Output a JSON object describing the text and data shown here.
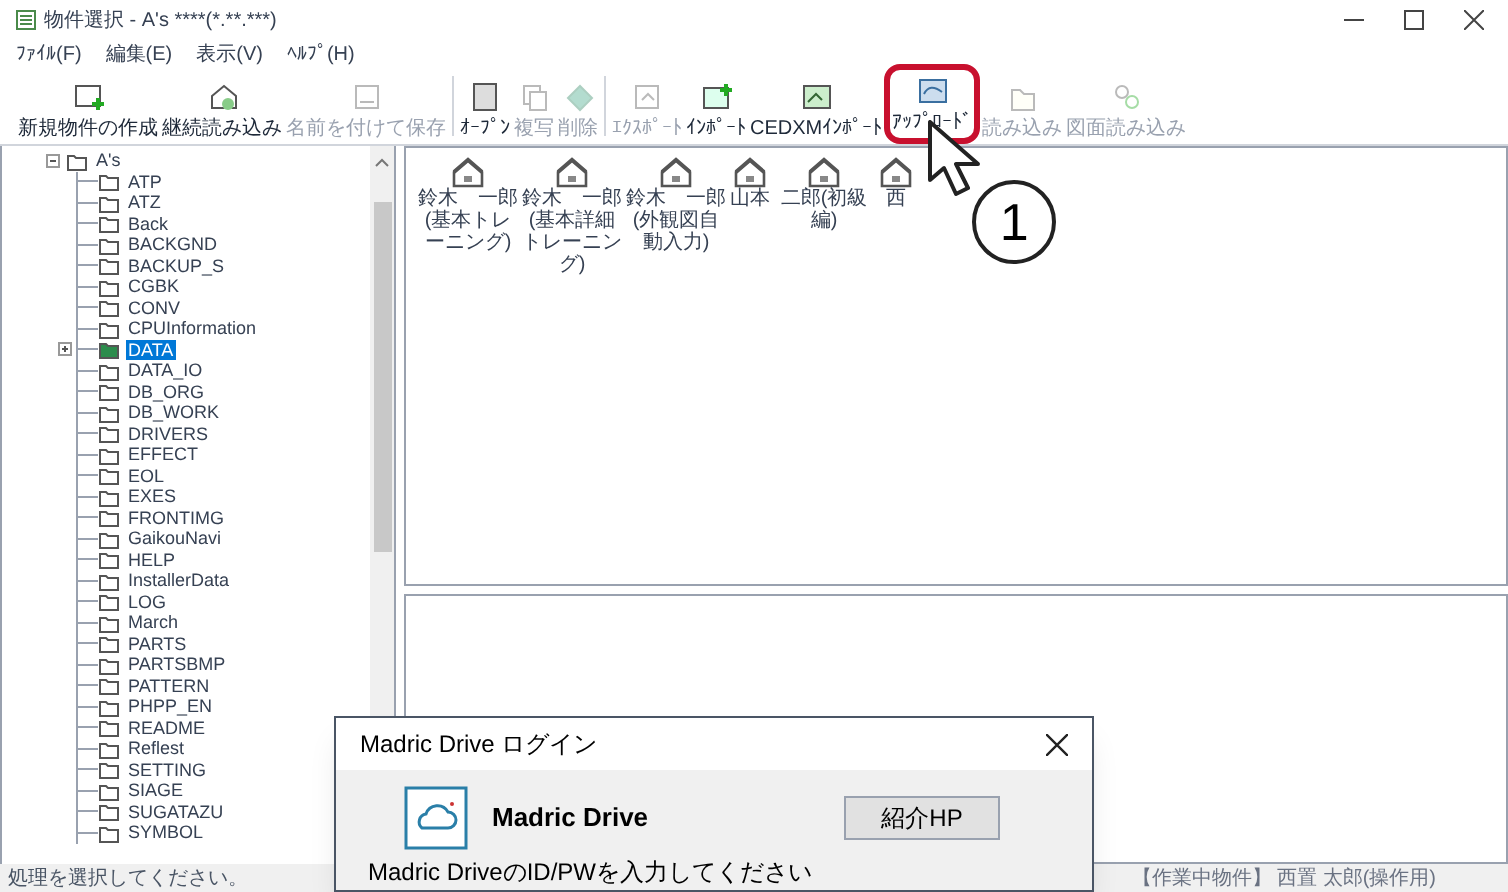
{
  "window": {
    "title": "物件選択 - A's ****(*.**.***)"
  },
  "menu": [
    "ﾌｧｲﾙ(F)",
    "編集(E)",
    "表示(V)",
    "ﾍﾙﾌﾟ(H)"
  ],
  "toolbar_groups": [
    [
      {
        "label": "新規物件の作成",
        "disabled": false,
        "highlighted": false
      },
      {
        "label": "継続読み込み",
        "disabled": false,
        "highlighted": false
      },
      {
        "label": "名前を付けて保存",
        "disabled": true,
        "highlighted": false
      }
    ],
    [
      {
        "label": "ｵｰﾌﾟﾝ",
        "disabled": false,
        "highlighted": false
      },
      {
        "label": "複写",
        "disabled": true,
        "highlighted": false
      },
      {
        "label": "削除",
        "disabled": true,
        "highlighted": false
      }
    ],
    [
      {
        "label": "ｴｸｽﾎﾟｰﾄ",
        "disabled": true,
        "highlighted": false
      },
      {
        "label": "ｲﾝﾎﾟｰﾄ",
        "disabled": false,
        "highlighted": false
      },
      {
        "label": "CEDXMｲﾝﾎﾟｰﾄ",
        "disabled": false,
        "highlighted": false
      },
      {
        "label": "ｱｯﾌﾟﾛｰﾄﾞ",
        "disabled": false,
        "highlighted": true
      },
      {
        "label": "読み込み",
        "disabled": true,
        "highlighted": false
      },
      {
        "label": "図面読み込み",
        "disabled": true,
        "highlighted": false
      }
    ]
  ],
  "tree": [
    {
      "label": "A's",
      "selected": false,
      "expanded": true,
      "children": [
        {
          "label": "ATP",
          "selected": false
        },
        {
          "label": "ATZ",
          "selected": false
        },
        {
          "label": "Back",
          "selected": false
        },
        {
          "label": "BACKGND",
          "selected": false
        },
        {
          "label": "BACKUP_S",
          "selected": false
        },
        {
          "label": "CGBK",
          "selected": false
        },
        {
          "label": "CONV",
          "selected": false
        },
        {
          "label": "CPUInformation",
          "selected": false
        },
        {
          "label": "DATA",
          "selected": true
        },
        {
          "label": "DATA_IO",
          "selected": false
        },
        {
          "label": "DB_ORG",
          "selected": false
        },
        {
          "label": "DB_WORK",
          "selected": false
        },
        {
          "label": "DRIVERS",
          "selected": false
        },
        {
          "label": "EFFECT",
          "selected": false
        },
        {
          "label": "EOL",
          "selected": false
        },
        {
          "label": "EXES",
          "selected": false
        },
        {
          "label": "FRONTIMG",
          "selected": false
        },
        {
          "label": "GaikouNavi",
          "selected": false
        },
        {
          "label": "HELP",
          "selected": false
        },
        {
          "label": "InstallerData",
          "selected": false
        },
        {
          "label": "LOG",
          "selected": false
        },
        {
          "label": "March",
          "selected": false
        },
        {
          "label": "PARTS",
          "selected": false
        },
        {
          "label": "PARTSBMP",
          "selected": false
        },
        {
          "label": "PATTERN",
          "selected": false
        },
        {
          "label": "PHPP_EN",
          "selected": false
        },
        {
          "label": "README",
          "selected": false
        },
        {
          "label": "Reflest",
          "selected": false
        },
        {
          "label": "SETTING",
          "selected": false
        },
        {
          "label": "SIAGE",
          "selected": false
        },
        {
          "label": "SUGATAZU",
          "selected": false
        },
        {
          "label": "SYMBOL",
          "selected": false
        }
      ]
    }
  ],
  "projects": [
    "鈴木　一郎(基本トレーニング)",
    "鈴木　一郎(基本詳細トレーニング)",
    "鈴木　一郎(外観図自動入力)",
    "山本",
    "二郎(初級編)",
    "西"
  ],
  "status_bar": {
    "message": "処理を選択してください。",
    "current_project": "【作業中物件】 西置 太郎(操作用)"
  },
  "dialog": {
    "title": "Madric Drive ログイン",
    "product": "Madric Drive",
    "button": "紹介HP",
    "instruction": "Madric DriveのID/PWを入力してください"
  },
  "callout": {
    "number": "1"
  }
}
